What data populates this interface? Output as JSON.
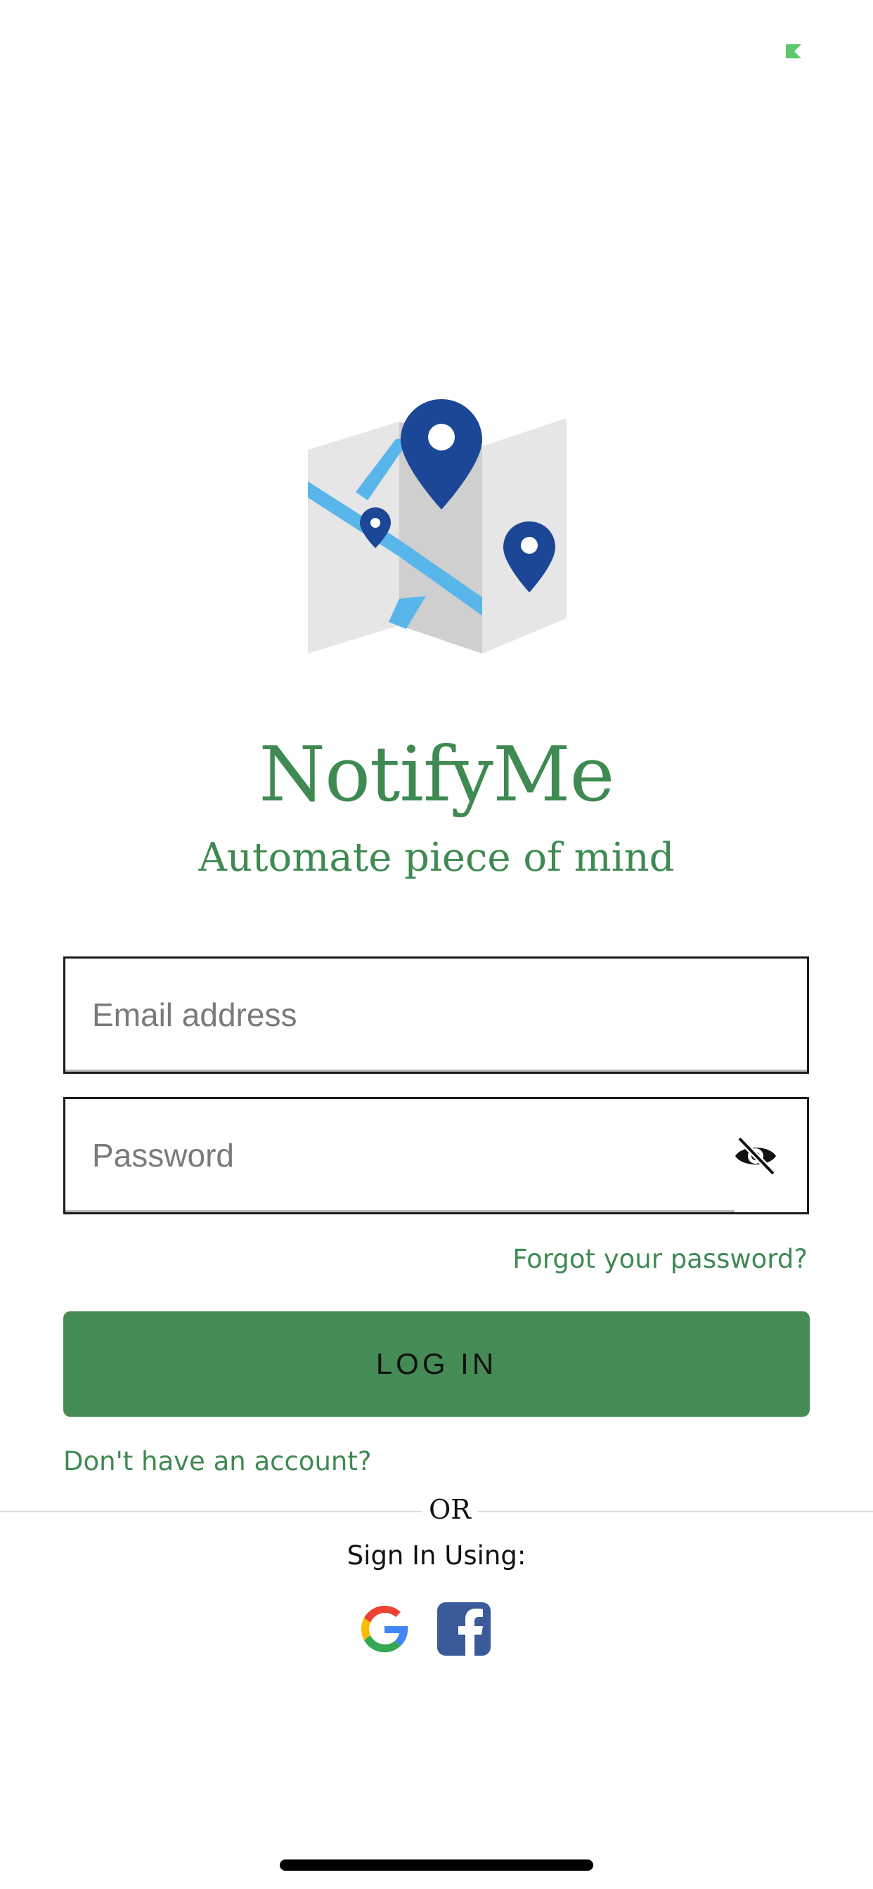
{
  "app": {
    "title": "NotifyMe",
    "tagline": "Automate piece of mind",
    "brand_color": "#3f8a52",
    "logo_icon": "folded-map-with-pins-icon"
  },
  "login_form": {
    "email": {
      "placeholder": "Email address",
      "value": ""
    },
    "password": {
      "placeholder": "Password",
      "value": "",
      "visibility_icon": "eye-slash-icon"
    },
    "forgot_password_label": "Forgot your password?",
    "login_button_label": "LOG IN",
    "login_button_color": "#458b55",
    "signup_prompt": "Don't have an account?"
  },
  "social": {
    "divider_text": "OR",
    "label": "Sign In Using:",
    "providers": [
      {
        "name": "Google",
        "icon": "google-icon"
      },
      {
        "name": "Facebook",
        "icon": "facebook-icon"
      }
    ]
  }
}
